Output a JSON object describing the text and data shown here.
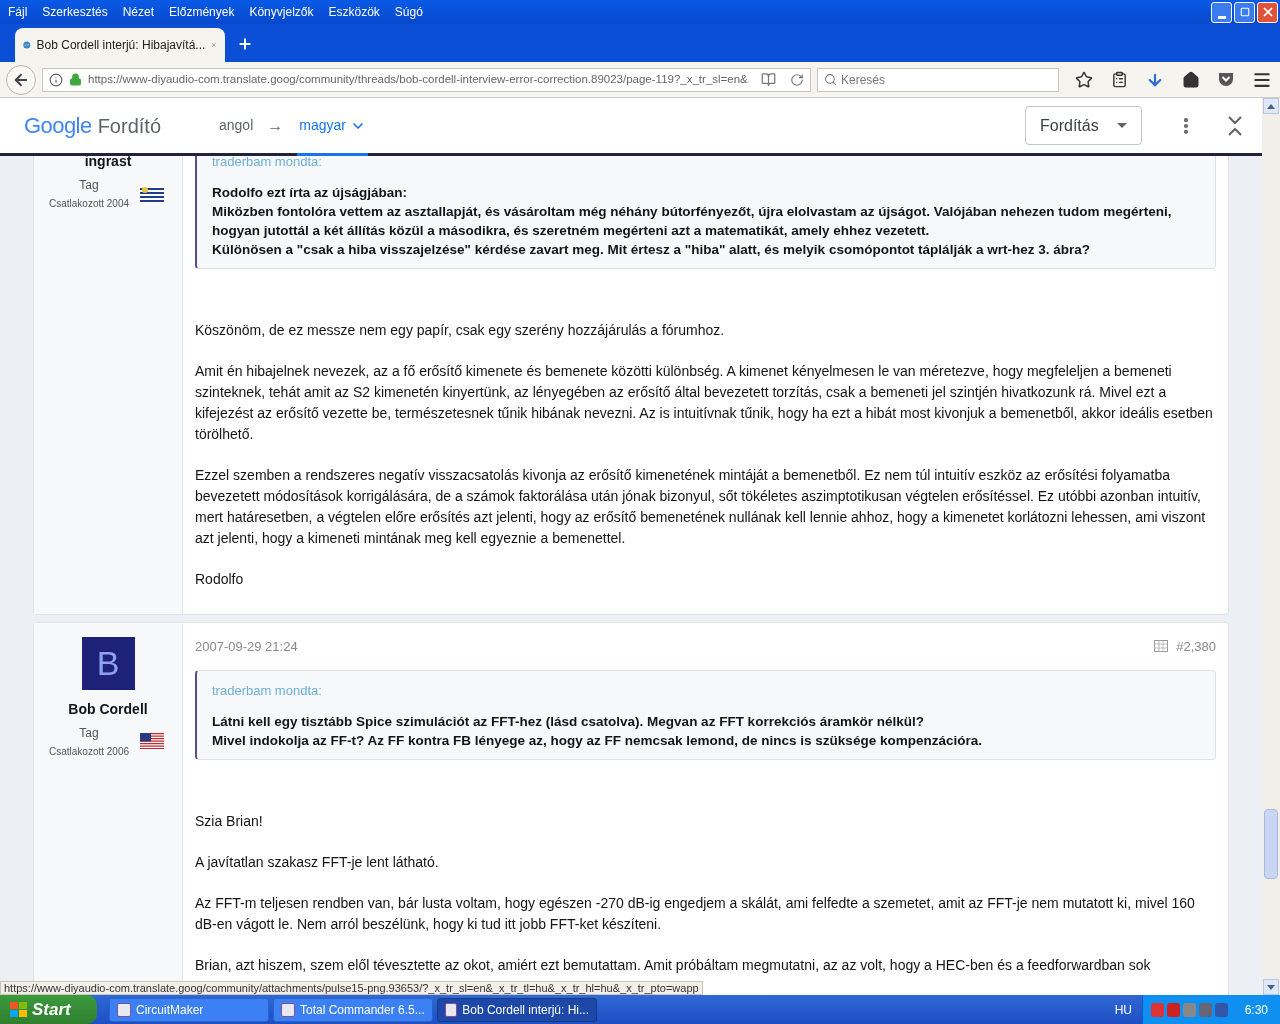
{
  "menu": [
    "Fájl",
    "Szerkesztés",
    "Nézet",
    "Előzmények",
    "Könyvjelzők",
    "Eszközök",
    "Súgó"
  ],
  "tabs": [
    {
      "title": "Bob Cordell interjú: Hibajavítá...",
      "selected": true
    }
  ],
  "address": {
    "url": "https://www-diyaudio-com.translate.goog/community/threads/bob-cordell-interview-error-correction.89023/page-119?_x_tr_sl=en&"
  },
  "search": {
    "placeholder": "Keresés"
  },
  "translate_bar": {
    "logo": "Google",
    "product": "Fordító",
    "source": "angol",
    "arrow": "→",
    "target": "magyar",
    "button": "Fordítás"
  },
  "posts": [
    {
      "author": "ingrast",
      "role": "Tag",
      "joined": "Csatlakozott 2004",
      "kind": "uruguay",
      "quote": {
        "attribution": "traderbam mondta:",
        "lines": [
          "Rodolfo ezt írta az újságjában:",
          "Miközben fontolóra vettem az asztallapját, és vásároltam még néhány bútorfényezőt, újra elolvastam az újságot. Valójában nehezen tudom megérteni, hogyan jutottál a két állítás közül a másodikra, és szeretném megérteni azt a matematikát, amely ehhez vezetett.",
          "Különösen a \"csak a hiba visszajelzése\" kérdése zavart meg. Mit értesz a \"hiba\" alatt, és melyik csomópontot táplálják a wrt-hez 3. ábra?"
        ]
      },
      "paragraphs": [
        "Köszönöm, de ez messze nem egy papír, csak egy szerény hozzájárulás a fórumhoz.",
        "Amit én hibajelnek nevezek, az a fő erősítő kimenete és bemenete közötti különbség. A kimenet kényelmesen le van méretezve, hogy megfeleljen a bemeneti szinteknek, tehát amit az S2 kimenetén kinyertünk, az lényegében az erősítő által bevezetett torzítás, csak a bemeneti jel szintjén hivatkozunk rá. Mivel ezt a kifejezést az erősítő vezette be, természetesnek tűnik hibának nevezni. Az is intuitívnak tűnik, hogy ha ezt a hibát most kivonjuk a bemenetből, akkor ideális esetben törölhető.",
        "Ezzel szemben a rendszeres negatív visszacsatolás kivonja az erősítő kimenetének mintáját a bemenetből. Ez nem túl intuitív eszköz az erősítési folyamatba bevezetett módosítások korrigálására, de a számok faktorálása után jónak bizonyul, sőt tökéletes aszimptotikusan végtelen erősítéssel. Ez utóbbi azonban intuitív, mert határesetben, a végtelen előre erősítés azt jelenti, hogy az erősítő bemenetének nullának kell lennie ahhoz, hogy a kimenetet korlátozni lehessen, ami viszont azt jelenti, hogy a kimeneti mintának meg kell egyeznie a bemenettel.",
        "Rodolfo"
      ]
    },
    {
      "author": "Bob Cordell",
      "avatar": "B",
      "role": "Tag",
      "joined": "Csatlakozott 2006",
      "kind": "usa",
      "date": "2007-09-29 21:24",
      "number": "#2,380",
      "quote": {
        "attribution": "traderbam mondta:",
        "lines": [
          "Látni kell egy tisztább Spice szimulációt az FFT-hez (lásd csatolva). Megvan az FFT korrekciós áramkör nélkül?",
          "Mivel indokolja az FF-t? Az FF kontra FB lényege az, hogy az FF nemcsak lemond, de nincs is szüksége kompenzációra."
        ]
      },
      "paragraphs": [
        "Szia Brian!",
        "A javítatlan szakasz FFT-je lent látható.",
        "Az FFT-m teljesen rendben van, bár lusta voltam, hogy egészen -270 dB-ig engedjem a skálát, ami felfedte a szemetet, amit az FFT-je nem mutatott ki, mivel 160 dB-en vágott le. Nem arról beszélünk, hogy ki tud itt jobb FFT-ket készíteni.",
        "Brian, azt hiszem, szem elől tévesztette az okot, amiért ezt bemutattam. Amit próbáltam megmutatni, az az volt, hogy a HEC-ben és a feedforwardban sok"
      ]
    }
  ],
  "status_url": "https://www-diyaudio-com.translate.goog/community/attachments/pulse15-png.93653/?_x_tr_sl=en&_x_tr_tl=hu&_x_tr_hl=hu&_x_tr_pto=wapp",
  "taskbar": {
    "start": "Start",
    "tasks": [
      {
        "label": "CircuitMaker",
        "selected": false
      },
      {
        "label": "Total Commander 6.5...",
        "selected": false
      },
      {
        "label": "Bob Cordell interjú: Hi...",
        "selected": true
      }
    ],
    "language": "HU",
    "clock": "6:30"
  }
}
